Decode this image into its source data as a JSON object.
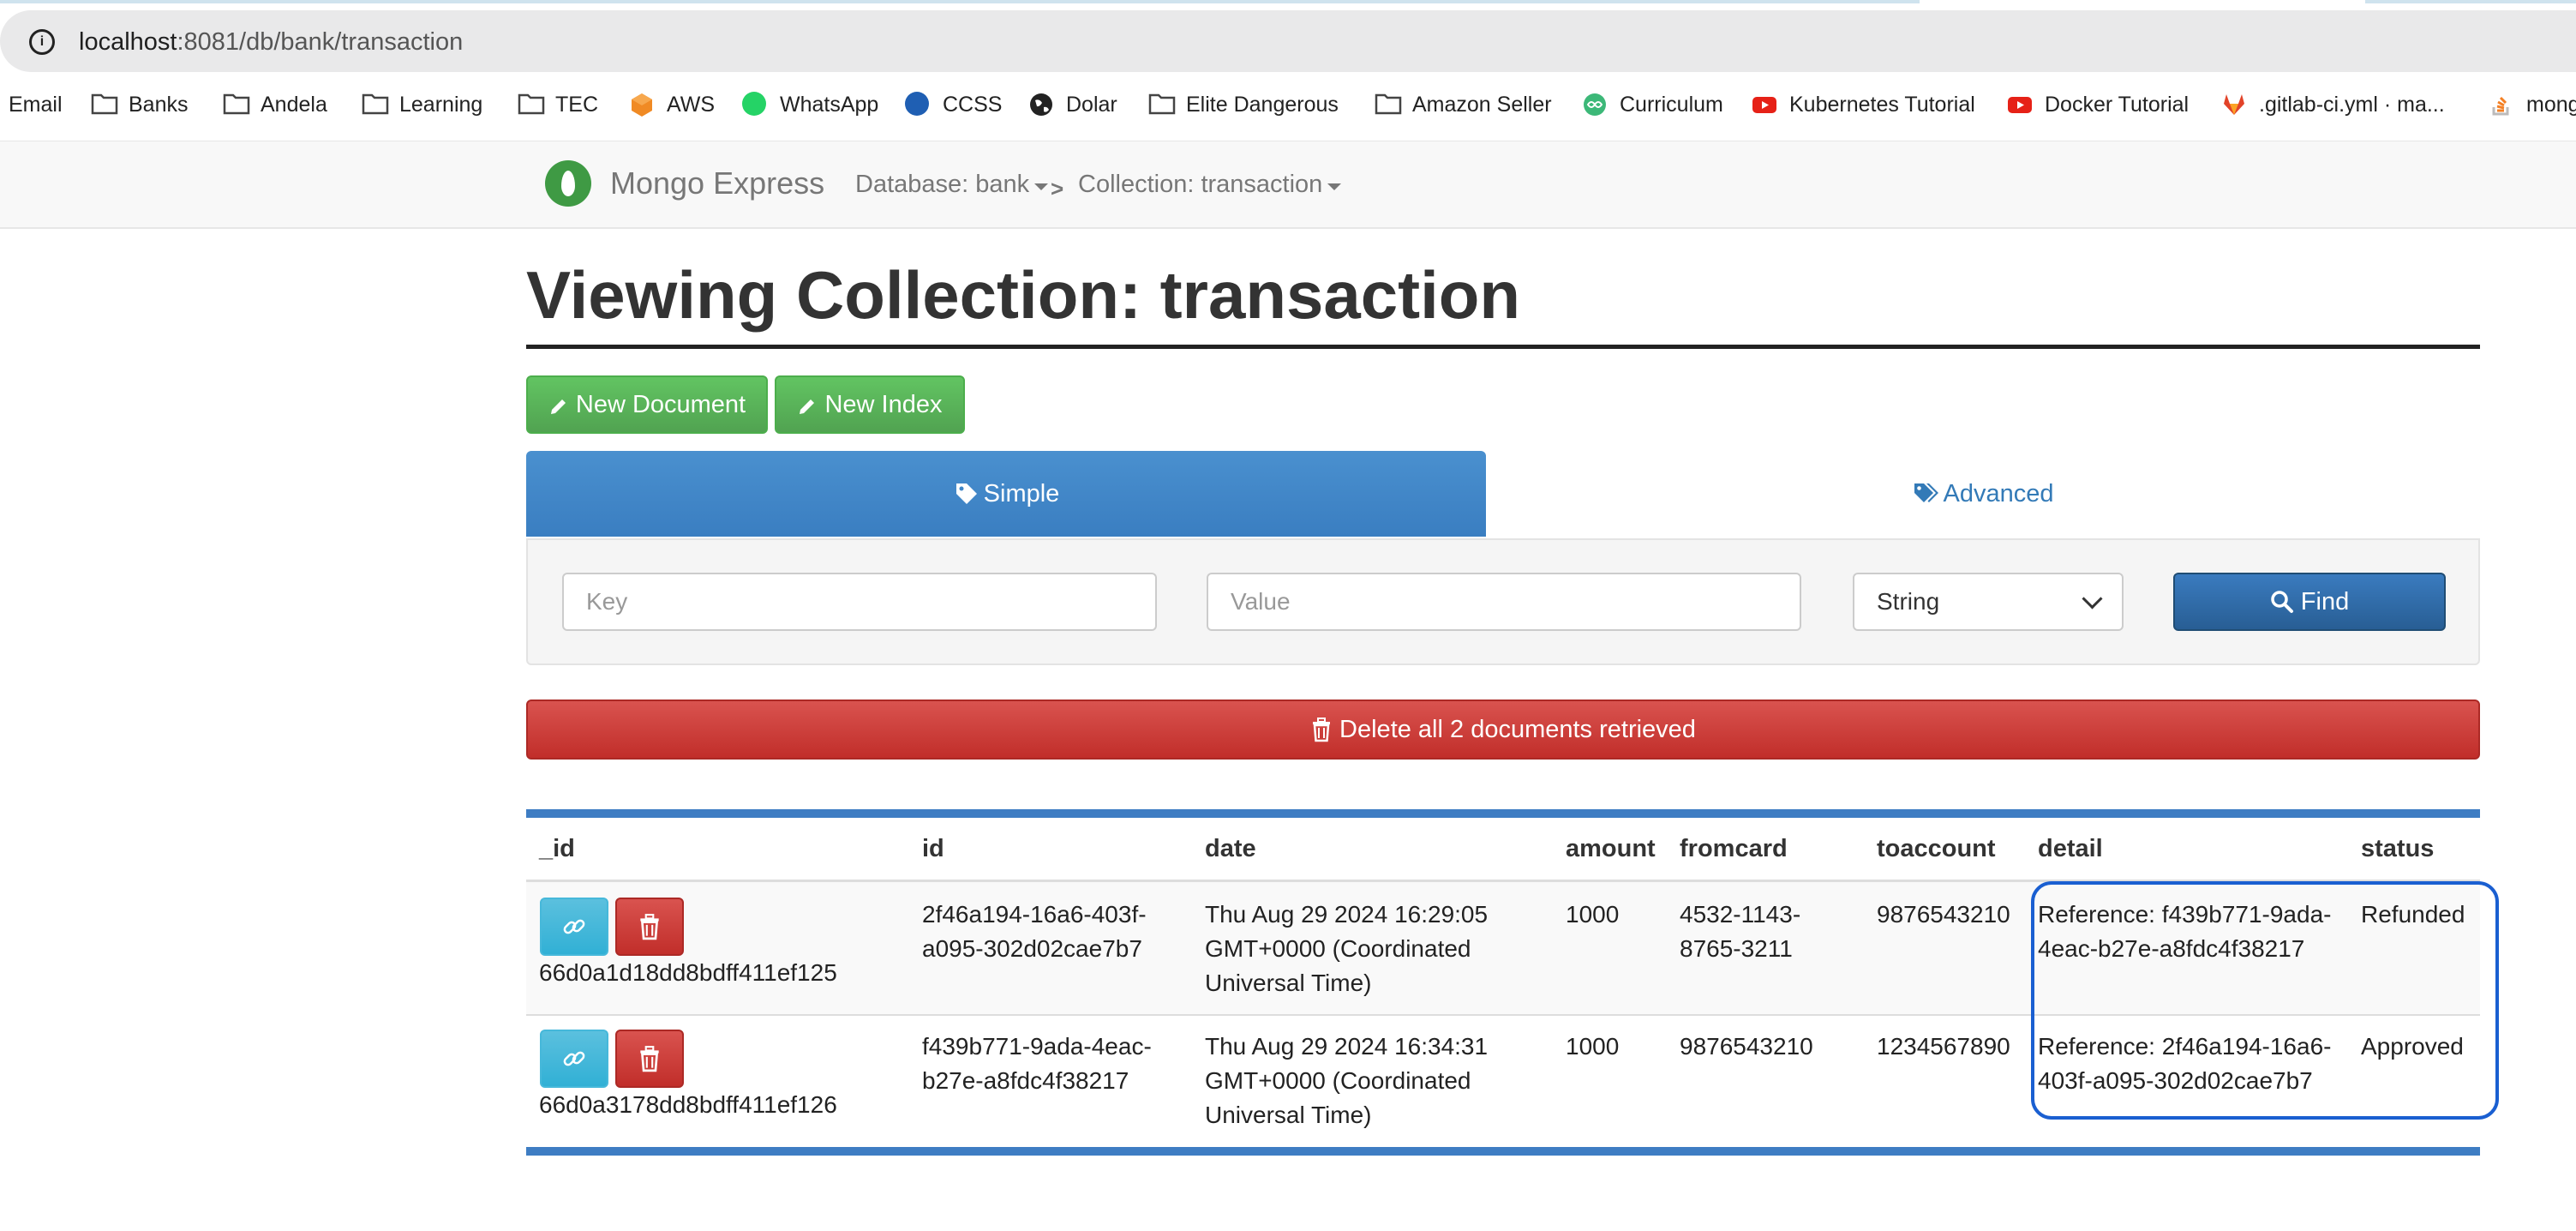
{
  "browser": {
    "url_host": "localhost",
    "url_path": ":8081/db/bank/transaction",
    "bookmarks": [
      {
        "label": "Email",
        "icon": "none"
      },
      {
        "label": "Banks",
        "icon": "folder-icon"
      },
      {
        "label": "Andela",
        "icon": "folder-icon"
      },
      {
        "label": "Learning",
        "icon": "folder-icon"
      },
      {
        "label": "TEC",
        "icon": "folder-icon"
      },
      {
        "label": "AWS",
        "icon": "aws-icon",
        "color": "#f08a24"
      },
      {
        "label": "WhatsApp",
        "icon": "whatsapp-icon",
        "color": "#25d366"
      },
      {
        "label": "CCSS",
        "icon": "ccss-icon",
        "color": "#1f5fb3"
      },
      {
        "label": "Dolar",
        "icon": "globe-icon",
        "color": "#222222"
      },
      {
        "label": "Elite Dangerous",
        "icon": "folder-icon"
      },
      {
        "label": "Amazon Seller",
        "icon": "folder-icon"
      },
      {
        "label": "Curriculum",
        "icon": "curriculum-icon",
        "color": "#3cb878"
      },
      {
        "label": "Kubernetes Tutorial",
        "icon": "youtube-icon",
        "color": "#e62117"
      },
      {
        "label": "Docker Tutorial",
        "icon": "youtube-icon",
        "color": "#e62117"
      },
      {
        "label": ".gitlab-ci.yml · ma...",
        "icon": "gitlab-icon",
        "color": "#e24329"
      },
      {
        "label": "mong",
        "icon": "stackoverflow-icon",
        "color": "#f48024"
      }
    ]
  },
  "navbar": {
    "brand": "Mongo Express",
    "database_crumb": "Database: bank",
    "collection_crumb": "Collection: transaction"
  },
  "page": {
    "title": "Viewing Collection: transaction",
    "new_document": "New Document",
    "new_index": "New Index"
  },
  "search": {
    "tab_simple": "Simple",
    "tab_advanced": "Advanced",
    "key_placeholder": "Key",
    "value_placeholder": "Value",
    "type_selected": "String",
    "find_label": "Find"
  },
  "delete_all_label": "Delete all 2 documents retrieved",
  "table": {
    "columns": [
      "_id",
      "id",
      "date",
      "amount",
      "fromcard",
      "toaccount",
      "detail",
      "status"
    ],
    "rows": [
      {
        "_id": "66d0a1d18dd8bdff411ef125",
        "id_lines": [
          "2f46a194-16a6-403f-",
          "a095-302d02cae7b7"
        ],
        "date_lines": [
          "Thu Aug 29 2024 16:29:05",
          "GMT+0000 (Coordinated",
          "Universal Time)"
        ],
        "amount": "1000",
        "fromcard_lines": [
          "4532-1143-",
          "8765-3211"
        ],
        "toaccount": "9876543210",
        "detail_lines": [
          "Reference: f439b771-9ada-",
          "4eac-b27e-a8fdc4f38217"
        ],
        "status": "Refunded"
      },
      {
        "_id": "66d0a3178dd8bdff411ef126",
        "id_lines": [
          "f439b771-9ada-4eac-",
          "b27e-a8fdc4f38217"
        ],
        "date_lines": [
          "Thu Aug 29 2024 16:34:31",
          "GMT+0000 (Coordinated",
          "Universal Time)"
        ],
        "amount": "1000",
        "fromcard_lines": [
          "9876543210"
        ],
        "toaccount": "1234567890",
        "detail_lines": [
          "Reference: 2f46a194-16a6-",
          "403f-a095-302d02cae7b7"
        ],
        "status": "Approved"
      }
    ]
  },
  "colors": {
    "brand_green": "#3f9a44",
    "primary_blue": "#428bca",
    "success_green": "#5cb85c",
    "danger_red": "#d9534f",
    "info_blue": "#5bc0de",
    "highlight_outline": "#1a5fd1"
  }
}
